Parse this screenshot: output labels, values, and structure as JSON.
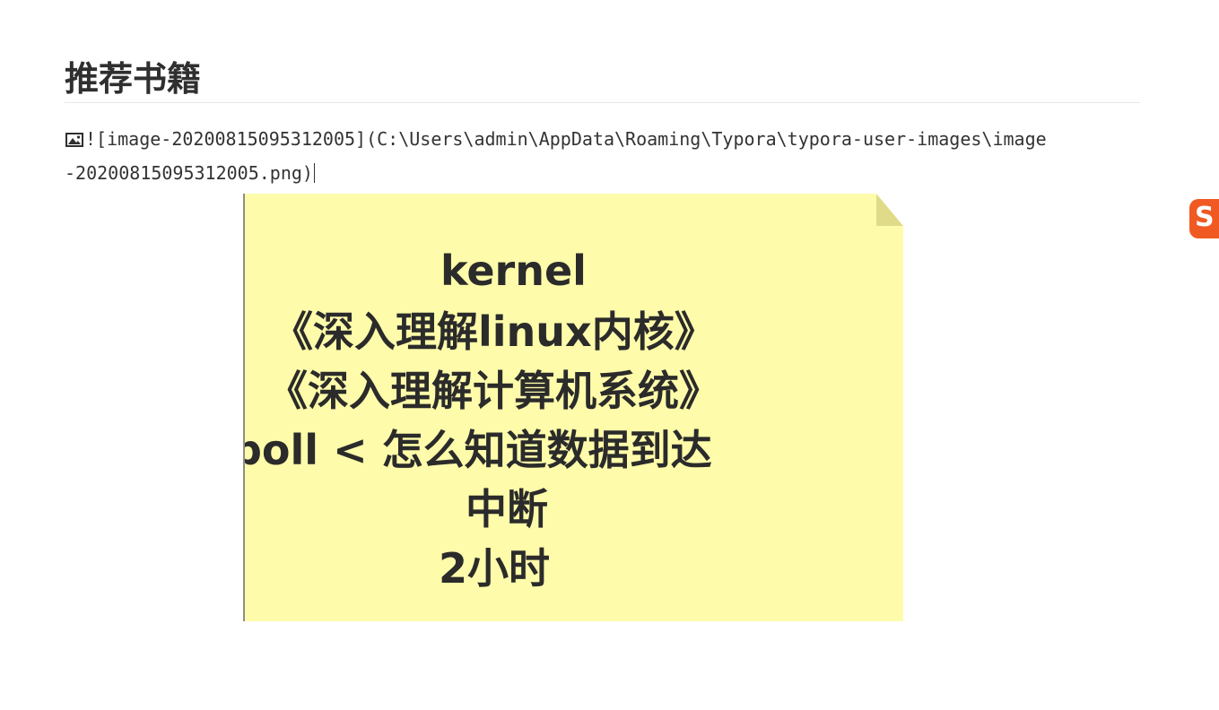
{
  "document": {
    "heading": "推荐书籍",
    "image_source": {
      "line1": "![image-20200815095312005](C:\\Users\\admin\\AppData\\Roaming\\Typora\\typora-user-images\\image",
      "line2": "-20200815095312005.png)"
    }
  },
  "sticky_note": {
    "background_color": "#fefcaa",
    "lines": [
      "kernel",
      "《深入理解linux内核》",
      "《深入理解计算机系统》",
      "poll   <  怎么知道数据到达",
      "中断",
      "2小时"
    ]
  },
  "ime_badge": {
    "icon": "sogou-ime-icon",
    "glyph": "S",
    "color": "#f05a22"
  }
}
